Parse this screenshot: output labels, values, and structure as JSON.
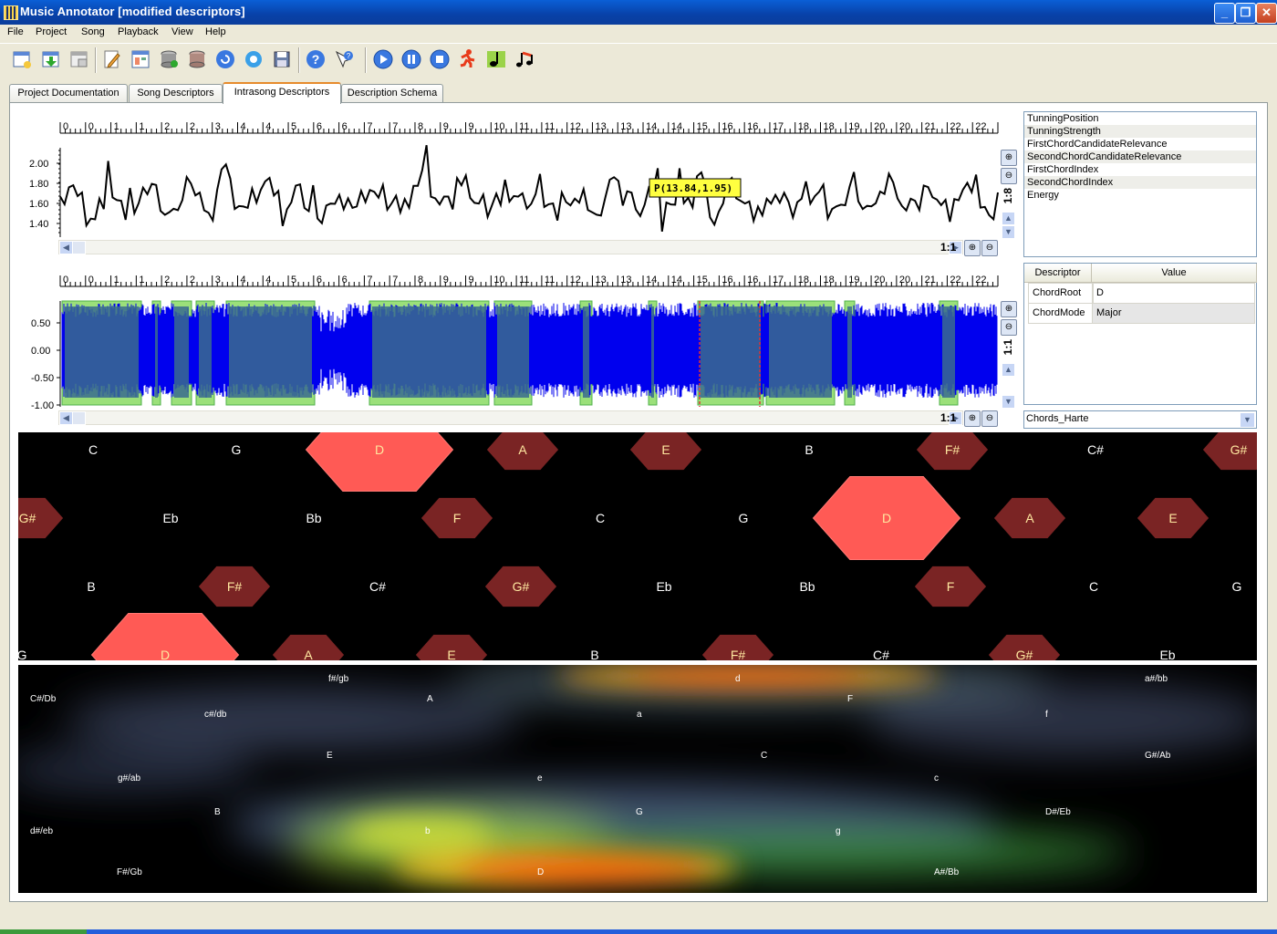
{
  "window": {
    "title": "Music Annotator [modified descriptors]"
  },
  "menu": [
    "File",
    "Project",
    "Song",
    "Playback",
    "View",
    "Help"
  ],
  "toolbar_icons": [
    "new-project-icon",
    "open-project-icon",
    "close-project-icon",
    "edit-icon",
    "layout-icon",
    "add-db-icon",
    "db-icon",
    "refresh-icon",
    "settings-icon",
    "save-icon",
    "help-icon",
    "whats-this-icon",
    "play-icon",
    "pause-icon",
    "stop-icon",
    "runner-icon",
    "note-icon",
    "multi-note-icon"
  ],
  "tabs": [
    {
      "label": "Project Documentation"
    },
    {
      "label": "Song Descriptors"
    },
    {
      "label": "Intrasong Descriptors",
      "active": true
    },
    {
      "label": "Description Schema"
    }
  ],
  "time_ruler_labels": [
    "0",
    "0",
    "1",
    "1",
    "2",
    "2",
    "3",
    "4",
    "4",
    "5",
    "6",
    "6",
    "7",
    "7",
    "8",
    "9",
    "9",
    "10",
    "11",
    "11",
    "12",
    "13",
    "13",
    "14",
    "14",
    "15",
    "16",
    "16",
    "17",
    "18",
    "18",
    "19",
    "20",
    "20",
    "21",
    "22",
    "22"
  ],
  "energy_plot": {
    "y_ticks": [
      "2.00",
      "1.80",
      "1.60",
      "1.40"
    ],
    "tooltip": "P(13.84,1.95)",
    "h_zoom": "1:1",
    "v_zoom": "1:8",
    "series_line_color": "#000000"
  },
  "waveform_plot": {
    "y_ticks": [
      "0.50",
      "0.00",
      "-0.50",
      "-1.00"
    ],
    "h_zoom": "1:1",
    "v_zoom": "1:1",
    "wave_color": "#0000ee",
    "segment_color": "#9be07a"
  },
  "descriptor_list": [
    "TunningPosition",
    "TunningStrength",
    "FirstChordCandidateRelevance",
    "SecondChordCandidateRelevance",
    "FirstChordIndex",
    "SecondChordIndex",
    "Energy"
  ],
  "descriptor_table": {
    "headers": [
      "Descriptor",
      "Value"
    ],
    "rows": [
      [
        "ChordRoot",
        "D"
      ],
      [
        "ChordMode",
        "Major"
      ]
    ]
  },
  "schema_select": "Chords_Harte",
  "tonnetz": {
    "rows": [
      [
        "C",
        "G",
        "D",
        "A",
        "E",
        "B",
        "F#",
        "C#",
        "G#"
      ],
      [
        "G#",
        "Eb",
        "Bb",
        "F",
        "C",
        "G",
        "D",
        "A",
        "E"
      ],
      [
        "B",
        "F#",
        "C#",
        "G#",
        "Eb",
        "Bb",
        "F",
        "C",
        "G"
      ],
      [
        "G",
        "D",
        "A",
        "E",
        "B",
        "F#",
        "C#",
        "G#",
        "Eb"
      ]
    ],
    "highlight_color": "#ff5a55",
    "dim_color": "#7a2424"
  },
  "keymap_labels": [
    "f#/gb",
    "d",
    "a#/bb",
    "C#/Db",
    "A",
    "F",
    "c#/db",
    "a",
    "f",
    "E",
    "C",
    "G#/Ab",
    "g#/ab",
    "e",
    "c",
    "B",
    "G",
    "D#/Eb",
    "d#/eb",
    "b",
    "g",
    "F#/Gb",
    "D",
    "A#/Bb"
  ]
}
